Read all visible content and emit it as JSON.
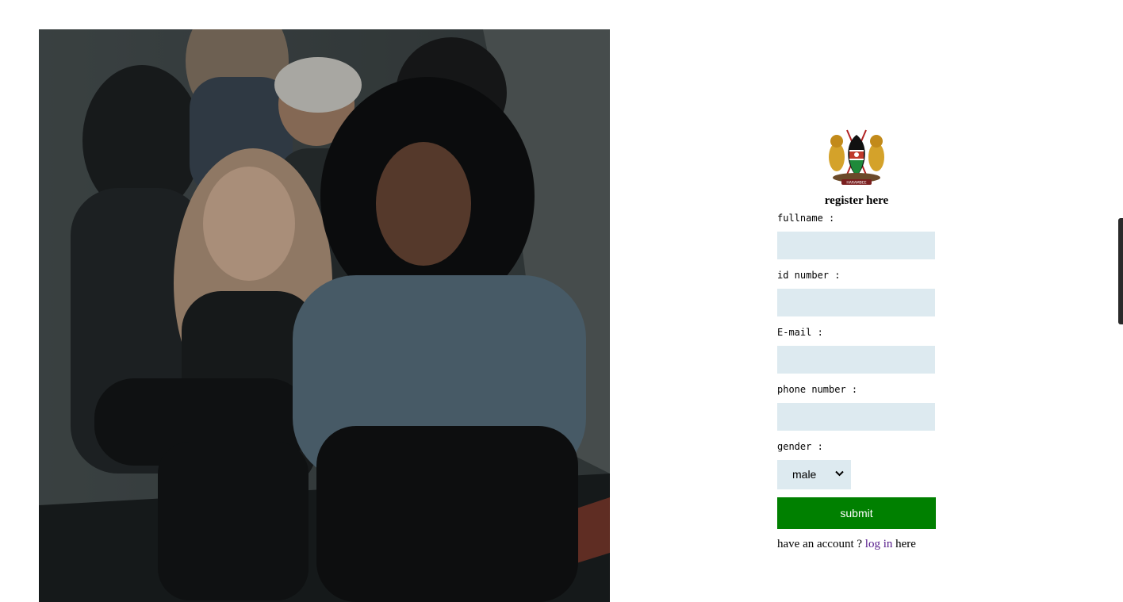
{
  "form": {
    "title": "register here",
    "fields": [
      {
        "label": "fullname :",
        "value": "",
        "placeholder": ""
      },
      {
        "label": "id number :",
        "value": "",
        "placeholder": ""
      },
      {
        "label": "E-mail :",
        "value": "",
        "placeholder": ""
      },
      {
        "label": "phone number :",
        "value": "",
        "placeholder": ""
      }
    ],
    "gender": {
      "label": "gender :",
      "selected": "male"
    },
    "submit_label": "submit",
    "account_prefix": "have an account ? ",
    "login_link": "log in",
    "account_suffix": " here",
    "emblem_motto": "HARAMBEE"
  },
  "hero": {
    "icon": "group-photo"
  },
  "colors": {
    "input_bg": "#ddeaf0",
    "submit_bg": "#008000",
    "submit_text": "#ffffff",
    "link": "#551a8b"
  }
}
